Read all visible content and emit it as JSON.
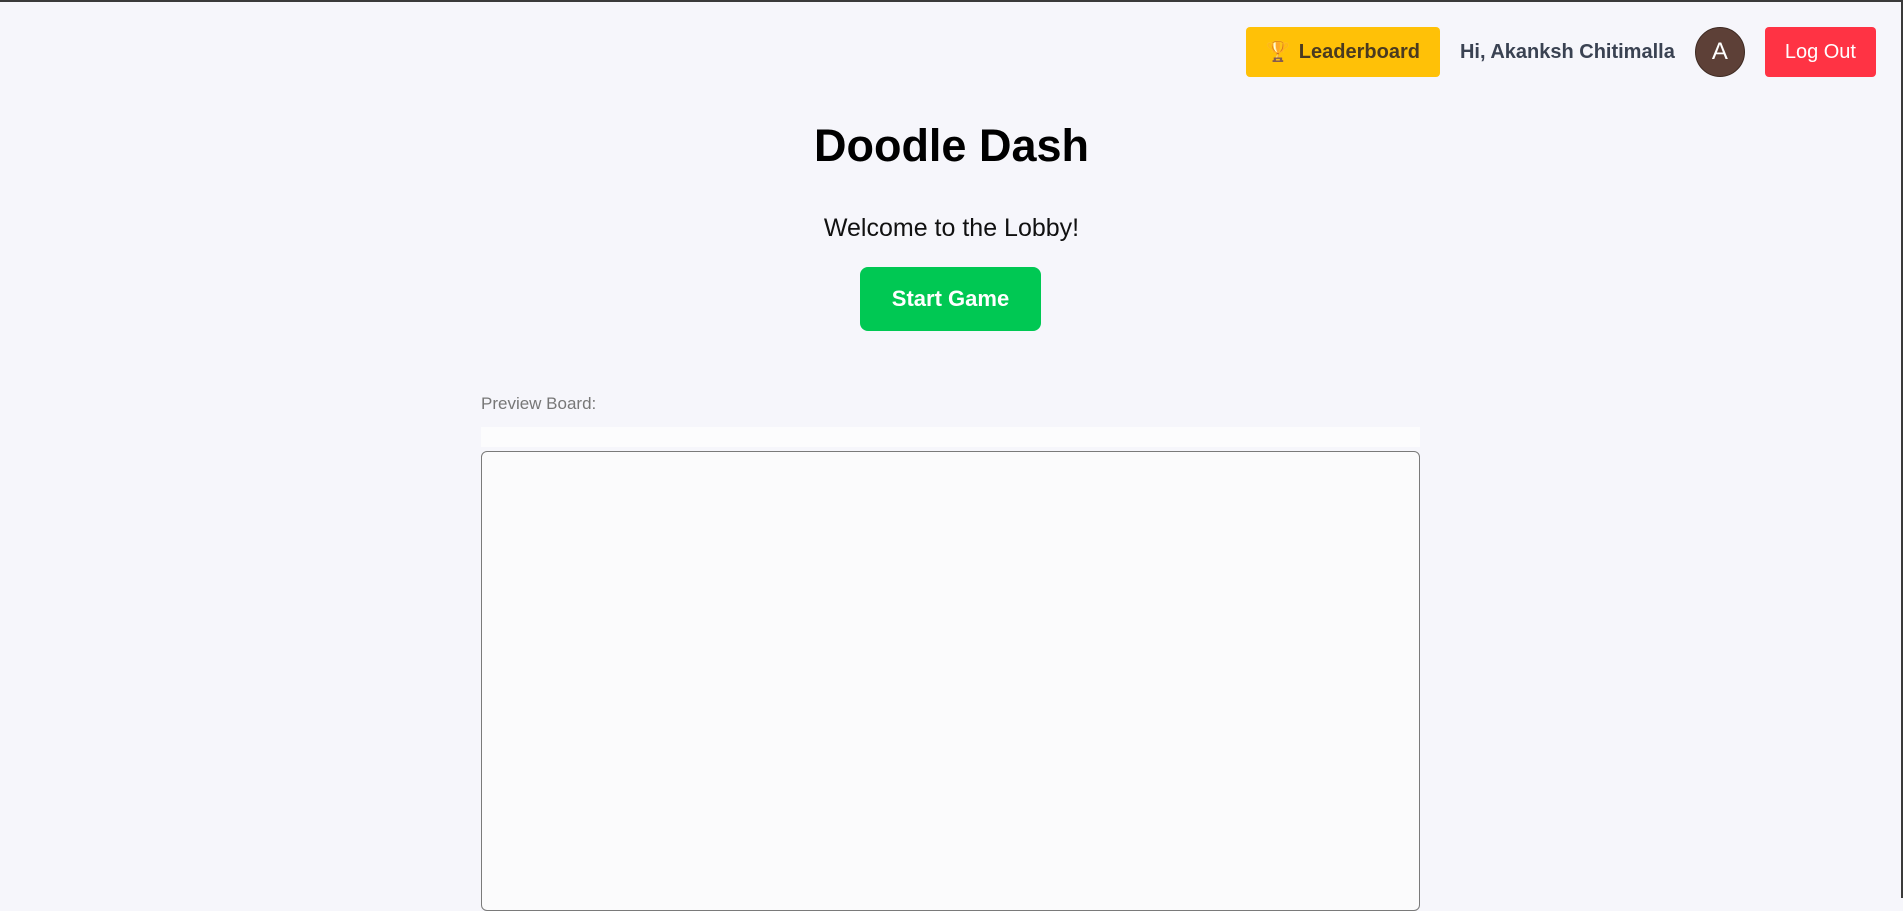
{
  "header": {
    "leaderboard_icon": "trophy-icon",
    "leaderboard_glyph": "🏆",
    "leaderboard_label": "Leaderboard",
    "greeting": "Hi, Akanksh Chitimalla",
    "avatar_initial": "A",
    "logout_label": "Log Out"
  },
  "main": {
    "title": "Doodle Dash",
    "welcome": "Welcome to the Lobby!",
    "start_label": "Start Game",
    "preview_label": "Preview Board:"
  },
  "colors": {
    "leaderboard": "#ffc107",
    "start": "#00c853",
    "logout": "#ff3344",
    "avatar": "#5d4037",
    "background": "#f6f6fb"
  }
}
